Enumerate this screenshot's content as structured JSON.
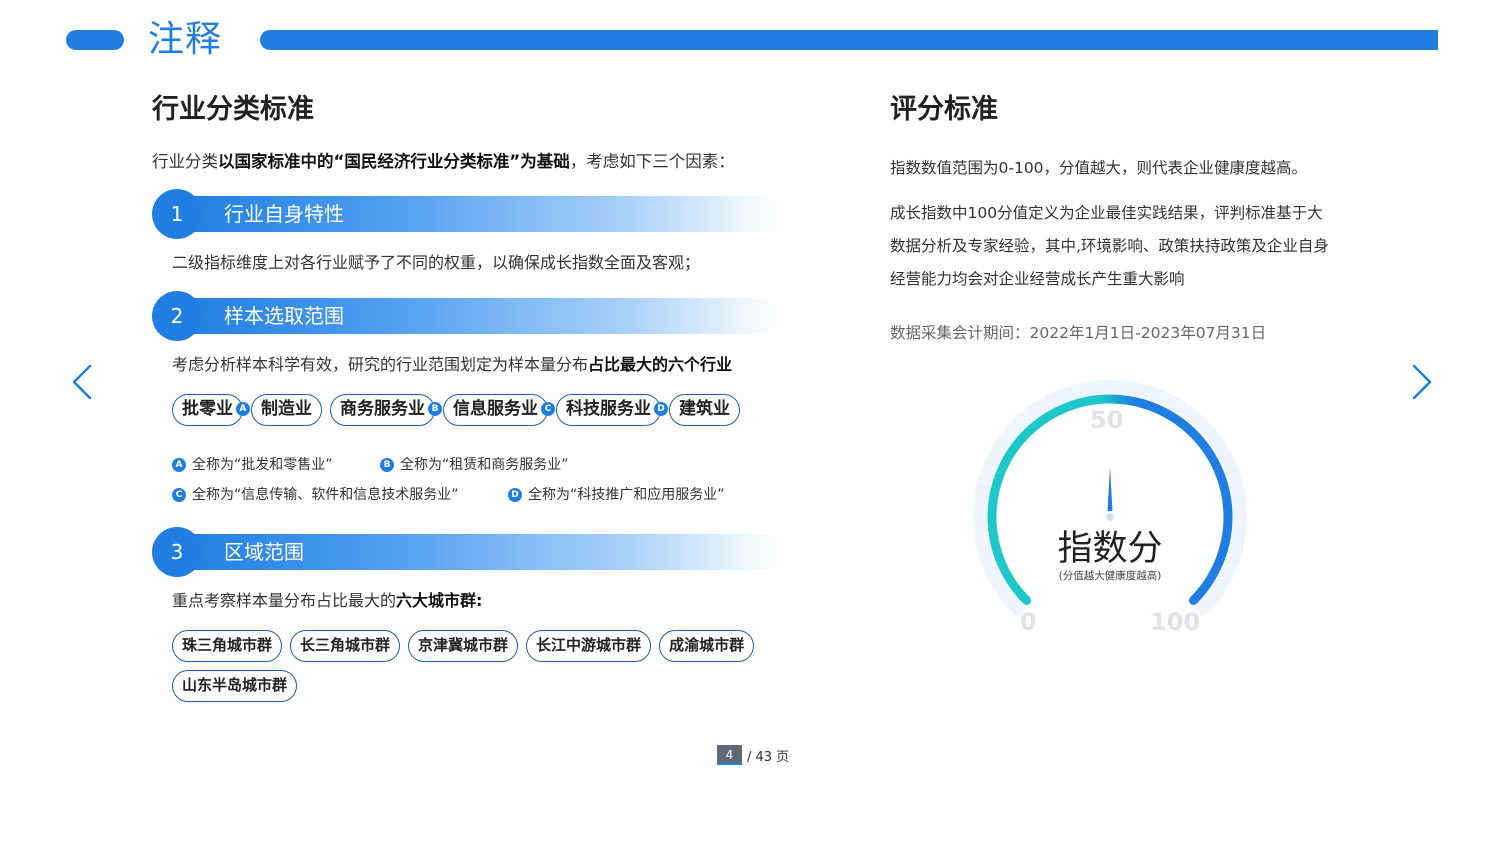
{
  "header": {
    "title": "注释"
  },
  "left": {
    "heading": "行业分类标准",
    "intro": {
      "pre": "行业分类",
      "bold": "以国家标准中的“国民经济行业分类标准”为基础",
      "post": "，考虑如下三个因素："
    },
    "factors": [
      {
        "num": "1",
        "label": "行业自身特性",
        "desc": "二级指标维度上对各行业赋予了不同的权重，以确保成长指数全面及客观；"
      },
      {
        "num": "2",
        "label": "样本选取范围",
        "desc_pre": "考虑分析样本科学有效，研究的行业范围划定为样本量分布",
        "desc_bold": "占比最大的六个行业"
      },
      {
        "num": "3",
        "label": "区域范围",
        "desc_pre": "重点考察样本量分布占比最大的",
        "desc_bold": "六大城市群:"
      }
    ],
    "industries": [
      {
        "name": "批零业",
        "badge": "A"
      },
      {
        "name": "制造业",
        "badge": ""
      },
      {
        "name": "商务服务业",
        "badge": "B"
      },
      {
        "name": "信息服务业",
        "badge": "C"
      },
      {
        "name": "科技服务业",
        "badge": "D"
      },
      {
        "name": "建筑业",
        "badge": ""
      }
    ],
    "notes": [
      {
        "badge": "A",
        "text": "全称为“批发和零售业”"
      },
      {
        "badge": "B",
        "text": "全称为“租赁和商务服务业”"
      },
      {
        "badge": "C",
        "text": "全称为“信息传输、软件和信息技术服务业”"
      },
      {
        "badge": "D",
        "text": "全称为“科技推广和应用服务业”"
      }
    ],
    "regions": [
      "珠三角城市群",
      "长三角城市群",
      "京津冀城市群",
      "长江中游城市群",
      "成渝城市群",
      "山东半岛城市群"
    ]
  },
  "right": {
    "heading": "评分标准",
    "p1": "指数数值范围为0-100，分值越大，则代表企业健康度越高。",
    "p2": "成长指数中100分值定义为企业最佳实践结果，评判标准基于大数据分析及专家经验，其中,环境影响、政策扶持政策及企业自身经营能力均会对企业经营成长产生重大影响",
    "period": "数据采集会计期间：2022年1月1日-2023年07月31日"
  },
  "gauge": {
    "title": "指数分",
    "subtitle": "(分值越大健康度越高)",
    "min_label": "0",
    "mid_label": "50",
    "max_label": "100",
    "value": 50,
    "colors": {
      "start": "#1ec8c8",
      "end": "#1f7ee0"
    }
  },
  "pager": {
    "current": "4",
    "total_text": "/ 43 页"
  },
  "colors": {
    "accent": "#1f7ee0"
  },
  "icons": {
    "prev": "chevron-left-icon",
    "next": "chevron-right-icon"
  }
}
